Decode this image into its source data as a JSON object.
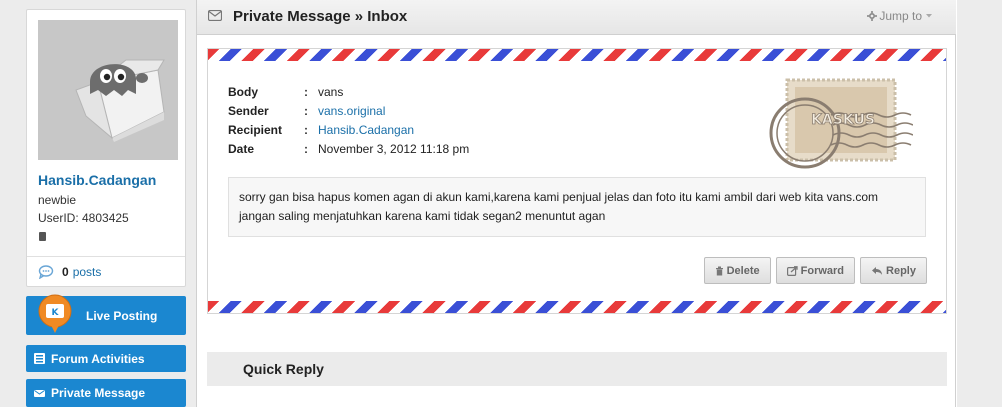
{
  "profile": {
    "username": "Hansib.Cadangan",
    "rank": "newbie",
    "userid": "UserID: 4803425",
    "post_count": "0",
    "posts_label": "posts",
    "avatar_icon": "ghost-mascot-icon"
  },
  "sidebar": {
    "live_posting": "Live Posting",
    "forum_activities": "Forum Activities",
    "private_message": "Private Message"
  },
  "header": {
    "title": "Private Message » Inbox",
    "jump_to": "Jump to"
  },
  "message": {
    "labels": {
      "body": "Body",
      "sender": "Sender",
      "recipient": "Recipient",
      "date": "Date",
      "separator": ":"
    },
    "body": "vans",
    "sender": "vans.original",
    "recipient": "Hansib.Cadangan",
    "date": "November 3, 2012 11:18 pm",
    "text": "sorry gan bisa hapus komen agan di akun kami,karena kami penjual jelas dan foto itu kami ambil dari web kita vans.com jangan saling menjatuhkan karena kami tidak segan2 menuntut agan",
    "stamp_text": "KASKUS"
  },
  "actions": {
    "delete": "Delete",
    "forward": "Forward",
    "reply": "Reply"
  },
  "quick_reply": {
    "title": "Quick Reply"
  },
  "colors": {
    "accent_blue": "#1b87d0",
    "link": "#1a6fa8",
    "airmail_red": "#e83a3a",
    "airmail_blue": "#3a4fd6"
  }
}
